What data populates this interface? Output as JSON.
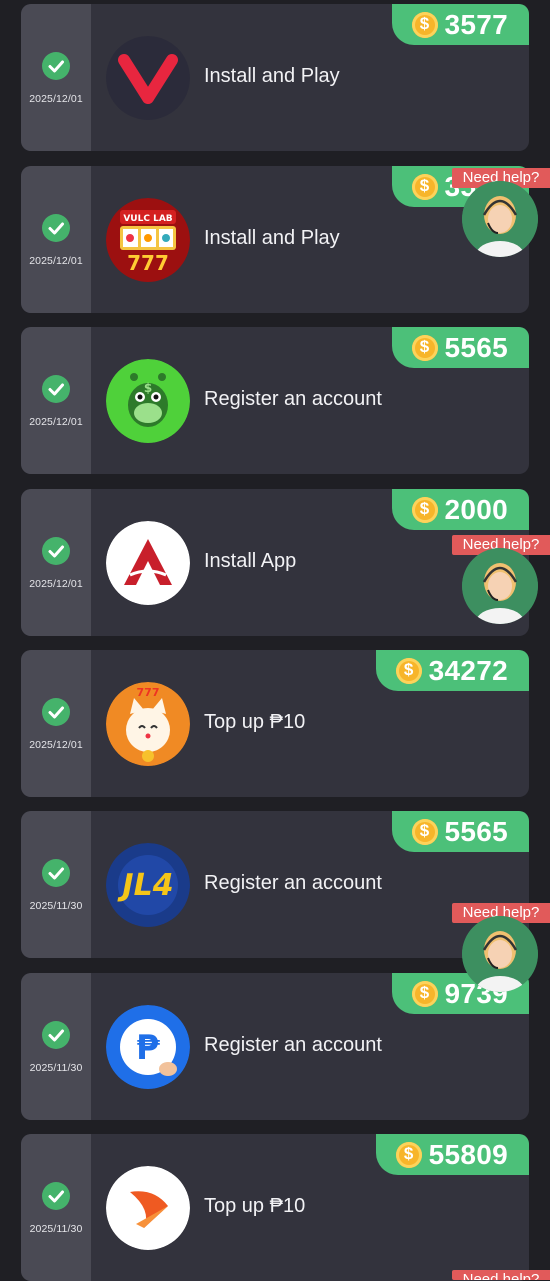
{
  "tasks": [
    {
      "date": "2025/12/01",
      "label": "Install and Play",
      "reward": "3577",
      "logo": "v-logo-icon"
    },
    {
      "date": "2025/12/01",
      "label": "Install and Play",
      "reward": "3577",
      "logo": "vulc-lab-slots-icon"
    },
    {
      "date": "2025/12/01",
      "label": "Register an account",
      "reward": "5565",
      "logo": "giraffe-money-icon"
    },
    {
      "date": "2025/12/01",
      "label": "Install App",
      "reward": "2000",
      "logo": "red-arrow-logo-icon"
    },
    {
      "date": "2025/12/01",
      "label": "Top up ₱10",
      "reward": "34272",
      "logo": "lucky-cat-icon"
    },
    {
      "date": "2025/11/30",
      "label": "Register an account",
      "reward": "5565",
      "logo": "jl4-logo-icon"
    },
    {
      "date": "2025/11/30",
      "label": "Register an account",
      "reward": "9739",
      "logo": "peso-wallet-icon"
    },
    {
      "date": "2025/11/30",
      "label": "Top up ₱10",
      "reward": "55809",
      "logo": "orange-swoosh-icon"
    }
  ],
  "help_widget": {
    "label": "Need help?"
  },
  "colors": {
    "background": "#1f1f24",
    "card": "#33333d",
    "sidebar": "#4a4a54",
    "reward": "#4cc079",
    "check": "#45b36b",
    "help": "#e15a5a"
  },
  "icons": {
    "check": "check-circle-icon",
    "coin": "coin-icon",
    "agent": "support-agent-avatar-icon"
  }
}
